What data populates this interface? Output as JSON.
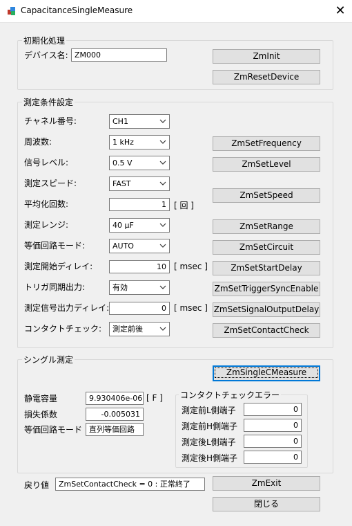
{
  "window": {
    "title": "CapacitanceSingleMeasure",
    "close_glyph": "✕"
  },
  "init_group": {
    "legend": "初期化処理",
    "device_label": "デバイス名:",
    "device_value": "ZM000",
    "zminit": "ZmInit",
    "zmreset": "ZmResetDevice"
  },
  "cond_group": {
    "legend": "測定条件設定",
    "channel_label": "チャネル番号:",
    "channel_value": "CH1",
    "freq_label": "周波数:",
    "freq_value": "1 kHz",
    "freq_btn": "ZmSetFrequency",
    "level_label": "信号レベル:",
    "level_value": "0.5 V",
    "level_btn": "ZmSetLevel",
    "speed_label": "測定スピード:",
    "speed_value": "FAST",
    "speed_btn": "ZmSetSpeed",
    "avg_label": "平均化回数:",
    "avg_value": "1",
    "avg_unit": "[ 回 ]",
    "range_label": "測定レンジ:",
    "range_value": "40 μF",
    "range_btn": "ZmSetRange",
    "circuit_label": "等価回路モード:",
    "circuit_value": "AUTO",
    "circuit_btn": "ZmSetCircuit",
    "delay_label": "測定開始ディレイ:",
    "delay_value": "10",
    "delay_unit": "[ msec ]",
    "delay_btn": "ZmSetStartDelay",
    "trigger_label": "トリガ同期出力:",
    "trigger_value": "有効",
    "trigger_btn": "ZmSetTriggerSyncEnable",
    "sigdelay_label": "測定信号出力ディレイ:",
    "sigdelay_value": "0",
    "sigdelay_unit": "[ msec ]",
    "sigdelay_btn": "ZmSetSignalOutputDelay",
    "contact_label": "コンタクトチェック:",
    "contact_value": "測定前後",
    "contact_btn": "ZmSetContactCheck"
  },
  "single_group": {
    "legend": "シングル測定",
    "measure_btn": "ZmSingleCMeasure",
    "cap_label": "静電容量",
    "cap_value": "9.930406e-06",
    "cap_unit": "[ F ]",
    "loss_label": "損失係数",
    "loss_value": "-0.005031",
    "mode_label": "等価回路モード",
    "mode_value": "直列等価回路",
    "contact_err": {
      "legend": "コンタクトチェックエラー",
      "pre_l_label": "測定前L側端子",
      "pre_l_value": "0",
      "pre_h_label": "測定前H側端子",
      "pre_h_value": "0",
      "post_l_label": "測定後L側端子",
      "post_l_value": "0",
      "post_h_label": "測定後H側端子",
      "post_h_value": "0"
    }
  },
  "footer": {
    "ret_label": "戻り値",
    "ret_value": "ZmSetContactCheck = 0 : 正常終了",
    "exit_btn": "ZmExit",
    "close_btn": "閉じる"
  }
}
